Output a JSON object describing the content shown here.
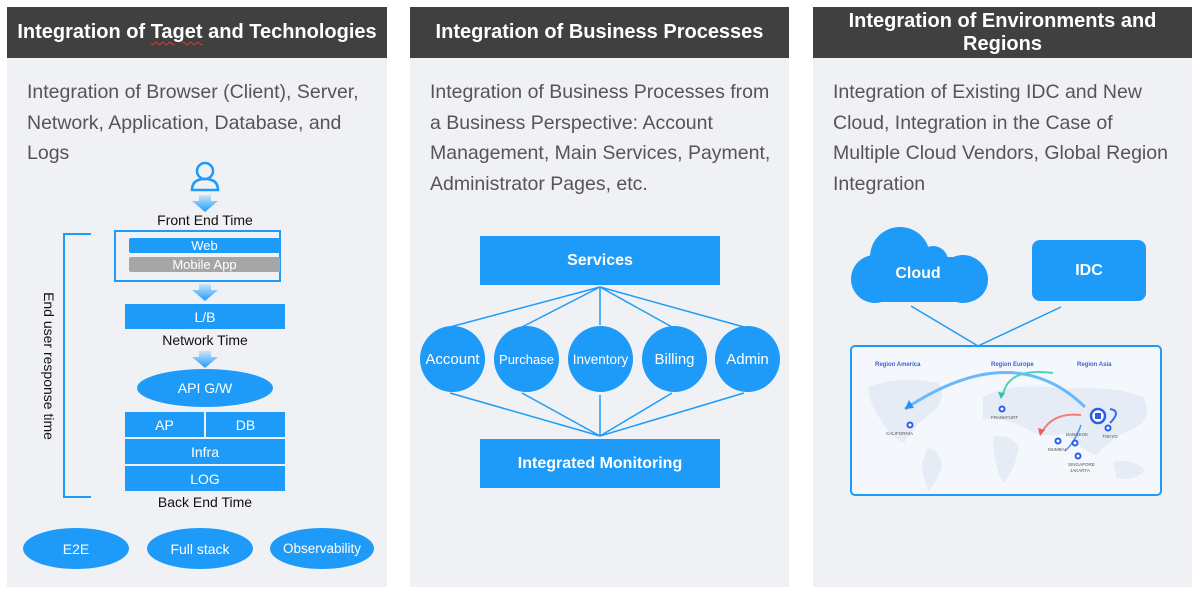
{
  "panels": [
    {
      "title_parts": [
        "Integration of ",
        "Taget",
        " and Technologies"
      ],
      "description": "Integration of Browser (Client), Server, Network, Application, Database, and Logs",
      "diagram": {
        "user_icon": "user-icon",
        "front_end_label": "Front End Time",
        "client_items": [
          "Web",
          "Mobile App"
        ],
        "lb_label": "L/B",
        "network_label": "Network Time",
        "api_gw_label": "API G/W",
        "ap_label": "AP",
        "db_label": "DB",
        "infra_label": "Infra",
        "log_label": "LOG",
        "back_end_label": "Back End Time",
        "bracket_label": "End user response time"
      },
      "tags": [
        "E2E",
        "Full stack",
        "Observability"
      ]
    },
    {
      "title": "Integration of Business Processes",
      "description": "Integration of Business Processes from a Business Perspective: Account Management, Main Services, Payment, Administrator Pages, etc.",
      "diagram": {
        "top_label": "Services",
        "nodes": [
          "Account",
          "Purchase",
          "Inventory",
          "Billing",
          "Admin"
        ],
        "bottom_label": "Integrated Monitoring"
      }
    },
    {
      "title": "Integration of Environments and Regions",
      "description": "Integration of Existing IDC and New Cloud, Integration in the Case of Multiple Cloud Vendors, Global Region Integration",
      "diagram": {
        "cloud_label": "Cloud",
        "idc_label": "IDC",
        "regions": [
          "Region America",
          "Region Europe",
          "Region Asia"
        ],
        "cities": [
          "CALIFORNIA",
          "FRANKFURT",
          "MUMBAI",
          "BANGKOK",
          "TOKYO",
          "SINGAPORE",
          "JAKARTA"
        ]
      }
    }
  ],
  "colors": {
    "header_bg": "#404040",
    "panel_bg": "#eff1f5",
    "accent_blue": "#1e9bf8",
    "gray_box": "#a6a6a6"
  }
}
